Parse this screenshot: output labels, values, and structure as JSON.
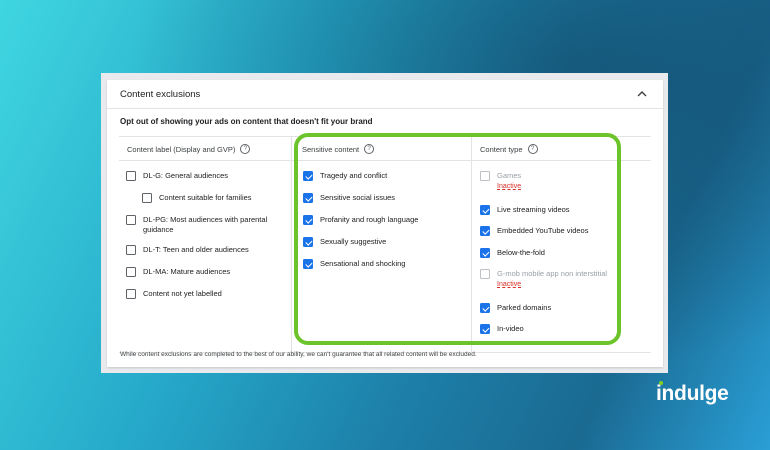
{
  "card": {
    "title": "Content exclusions",
    "subtitle": "Opt out of showing your ads on content that doesn't fit your brand",
    "footer_note": "While content exclusions are completed to the best of our ability, we can't guarantee that all related content will be excluded."
  },
  "columns": {
    "content_label": {
      "header": "Content label (Display and GVP)",
      "items": [
        {
          "label": "DL-G: General audiences",
          "checked": false
        },
        {
          "label": "Content suitable for families",
          "checked": false
        },
        {
          "label": "DL-PG: Most audiences with parental guidance",
          "checked": false
        },
        {
          "label": "DL-T: Teen and older audiences",
          "checked": false
        },
        {
          "label": "DL-MA: Mature audiences",
          "checked": false
        },
        {
          "label": "Content not yet labelled",
          "checked": false
        }
      ]
    },
    "sensitive_content": {
      "header": "Sensitive content",
      "items": [
        {
          "label": "Tragedy and conflict",
          "checked": true
        },
        {
          "label": "Sensitive social issues",
          "checked": true
        },
        {
          "label": "Profanity and rough language",
          "checked": true
        },
        {
          "label": "Sexually suggestive",
          "checked": true
        },
        {
          "label": "Sensational and shocking",
          "checked": true
        }
      ]
    },
    "content_type": {
      "header": "Content type",
      "items": [
        {
          "label": "Games",
          "status": "Inactive",
          "checked": false,
          "disabled": true
        },
        {
          "label": "Live streaming videos",
          "checked": true
        },
        {
          "label": "Embedded YouTube videos",
          "checked": true
        },
        {
          "label": "Below-the-fold",
          "checked": true
        },
        {
          "label": "G-mob mobile app non interstitial",
          "status": "Inactive",
          "checked": false,
          "disabled": true
        },
        {
          "label": "Parked domains",
          "checked": true
        },
        {
          "label": "In-video",
          "checked": true
        }
      ]
    }
  },
  "brand": {
    "logo_text": "indulge"
  },
  "colors": {
    "accent": "#1a73e8",
    "highlight": "#6cc42a",
    "inactive": "#d93025"
  }
}
